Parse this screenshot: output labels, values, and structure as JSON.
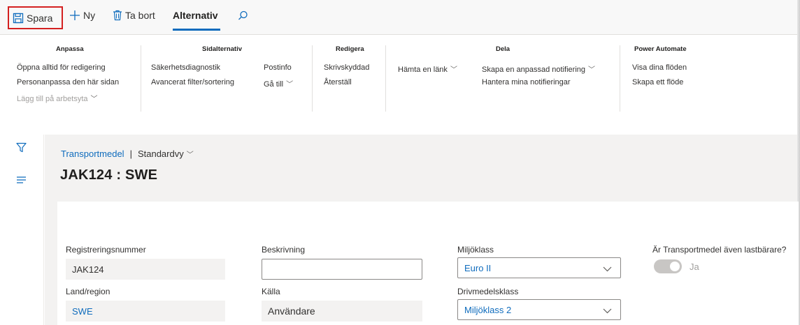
{
  "toolbar": {
    "save": "Spara",
    "new": "Ny",
    "delete": "Ta bort",
    "options_tab": "Alternativ"
  },
  "ribbon": {
    "groups": {
      "anpassa": {
        "title": "Anpassa",
        "items": [
          "Öppna alltid för redigering",
          "Personanpassa den här sidan",
          "Lägg till på arbetsyta"
        ]
      },
      "sidalternativ": {
        "title": "Sidalternativ",
        "col1": [
          "Säkerhetsdiagnostik",
          "Avancerat filter/sortering"
        ],
        "col2": [
          "Postinfo",
          "Gå till"
        ]
      },
      "redigera": {
        "title": "Redigera",
        "items": [
          "Skrivskyddad",
          "Återställ"
        ]
      },
      "dela": {
        "title": "Dela",
        "col1": [
          "Hämta en länk"
        ],
        "col2": [
          "Skapa en anpassad notifiering",
          "Hantera mina notifieringar"
        ]
      },
      "power_automate": {
        "title": "Power Automate",
        "items": [
          "Visa dina flöden",
          "Skapa ett flöde"
        ]
      }
    }
  },
  "page": {
    "breadcrumb_link": "Transportmedel",
    "breadcrumb_sep": "|",
    "view_name": "Standardvy",
    "title": "JAK124 : SWE"
  },
  "form": {
    "reg_label": "Registreringsnummer",
    "reg_value": "JAK124",
    "country_label": "Land/region",
    "country_value": "SWE",
    "desc_label": "Beskrivning",
    "desc_value": "",
    "source_label": "Källa",
    "source_value": "Användare",
    "env_label": "Miljöklass",
    "env_value": "Euro II",
    "fuel_label": "Drivmedelsklass",
    "fuel_value": "Miljöklass 2",
    "carrier_label": "Är Transportmedel även lastbärare?",
    "carrier_value": "Ja"
  },
  "colors": {
    "accent": "#0f6cbd",
    "highlight_border": "#d42020"
  }
}
